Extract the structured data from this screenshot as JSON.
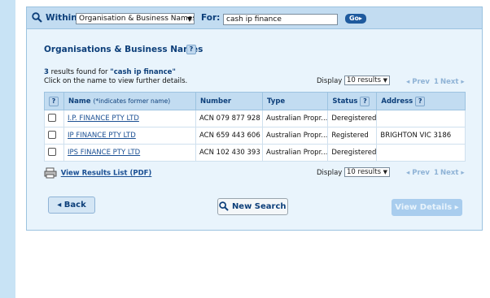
{
  "search": {
    "within_label": "Within:",
    "within_value": "Organisation & Business Names",
    "for_label": "For:",
    "for_value": "cash ip finance",
    "go_label": "Go"
  },
  "section": {
    "title": "Organisations & Business Names",
    "help": "?"
  },
  "results": {
    "count": "3",
    "count_text": " results found for ",
    "query": "\"cash ip finance\"",
    "hint": "Click on the name to view further details."
  },
  "pager": {
    "display_label": "Display",
    "display_value": "10 results",
    "prev": "◂ Prev",
    "page": "1",
    "next": "Next ▸"
  },
  "table": {
    "headers": {
      "help": "?",
      "name": "Name",
      "name_note": "(*indicates former name)",
      "number": "Number",
      "type": "Type",
      "status": "Status",
      "address": "Address"
    },
    "rows": [
      {
        "name": "I.P. FINANCE PTY LTD",
        "number": "ACN 079 877 928",
        "type": "Australian Propr...",
        "status": "Deregistered",
        "address": ""
      },
      {
        "name": "IP FINANCE PTY LTD",
        "number": "ACN 659 443 606",
        "type": "Australian Propr...",
        "status": "Registered",
        "address": "BRIGHTON VIC 3186"
      },
      {
        "name": "IPS FINANCE PTY LTD",
        "number": "ACN 102 430 393",
        "type": "Australian Propr...",
        "status": "Deregistered",
        "address": ""
      }
    ]
  },
  "pdf_link": "View Results List (PDF)",
  "buttons": {
    "back": "Back",
    "new_search": "New Search",
    "view_details": "View Details"
  },
  "colors": {
    "accent": "#0d3f7a",
    "panel_bg": "#e9f4fc",
    "header_bg": "#c2dcf1"
  }
}
